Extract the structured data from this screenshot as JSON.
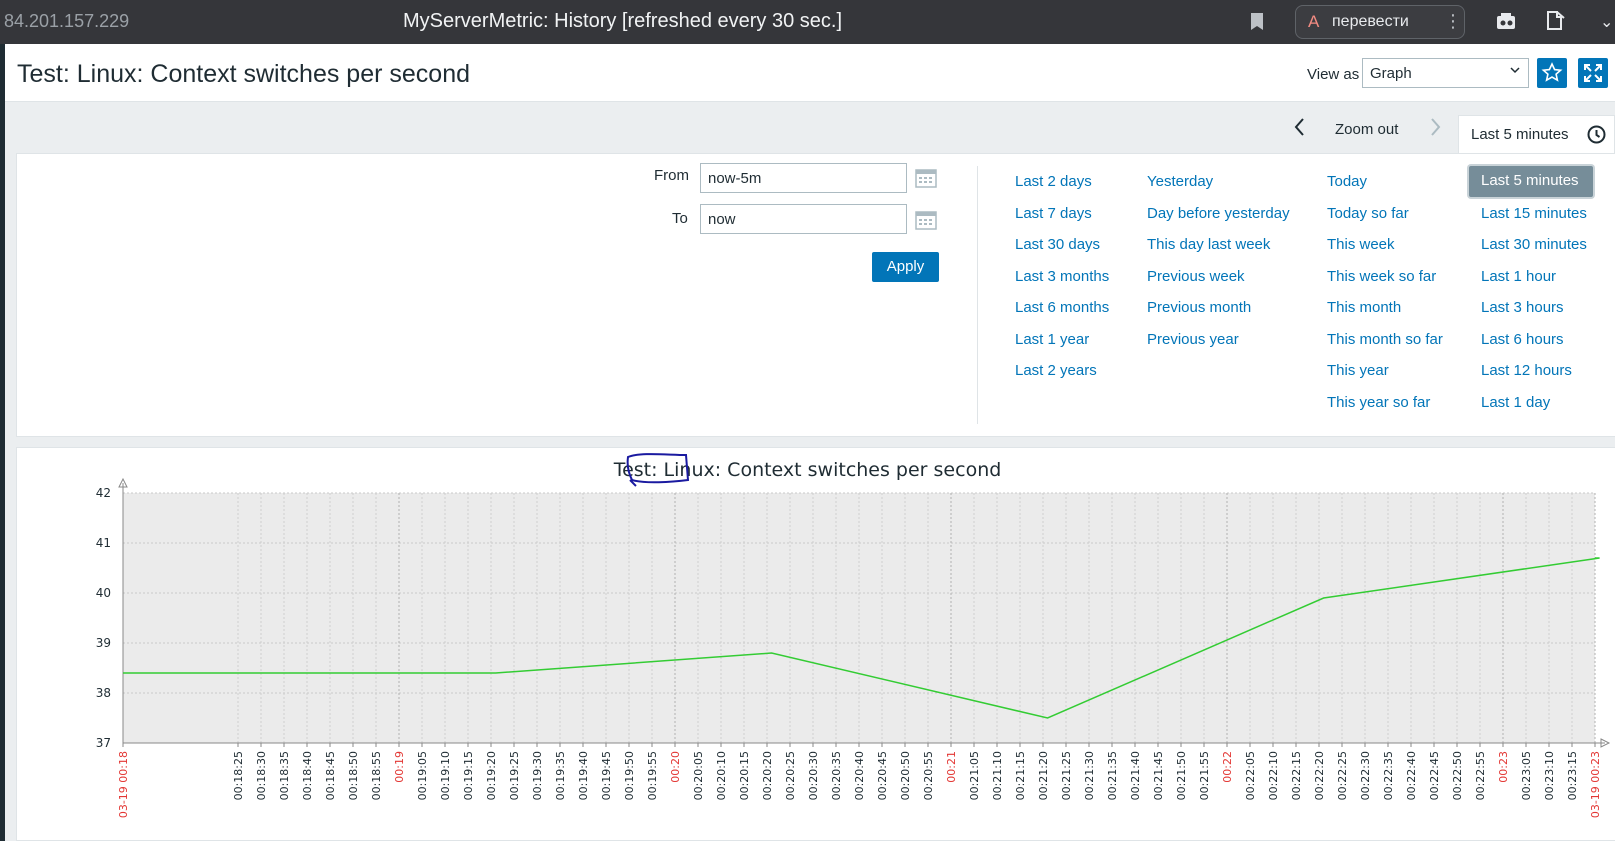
{
  "browser": {
    "address": "84.201.157.229",
    "window_title": "MyServerMetric: History [refreshed every 30 sec.]",
    "translate_label": "перевести"
  },
  "header": {
    "title": "Test: Linux: Context switches per second",
    "view_as_label": "View as",
    "view_as_value": "Graph"
  },
  "timenav": {
    "zoom_out": "Zoom out",
    "current_tab": "Last 5 minutes"
  },
  "filter": {
    "from_label": "From",
    "from_value": "now-5m",
    "to_label": "To",
    "to_value": "now",
    "apply": "Apply",
    "columns": [
      [
        "Last 2 days",
        "Last 7 days",
        "Last 30 days",
        "Last 3 months",
        "Last 6 months",
        "Last 1 year",
        "Last 2 years"
      ],
      [
        "Yesterday",
        "Day before yesterday",
        "This day last week",
        "Previous week",
        "Previous month",
        "Previous year"
      ],
      [
        "Today",
        "Today so far",
        "This week",
        "This week so far",
        "This month",
        "This month so far",
        "This year",
        "This year so far"
      ],
      [
        "Last 5 minutes",
        "Last 15 minutes",
        "Last 30 minutes",
        "Last 1 hour",
        "Last 3 hours",
        "Last 6 hours",
        "Last 12 hours",
        "Last 1 day"
      ]
    ],
    "selected": "Last 5 minutes"
  },
  "colors": {
    "accent": "#0275b8",
    "line": "#33cc33",
    "red_tick": "#e33734",
    "selected_bg": "#768d99"
  },
  "chart_data": {
    "type": "line",
    "title": "Test: Linux: Context switches per second",
    "ylim": [
      37,
      42
    ],
    "yticks": [
      37,
      38,
      39,
      40,
      41,
      42
    ],
    "x_start_label": "03-19 00:18",
    "x_end_label": "03-19 00:23",
    "x_ticks": [
      "00:18:25",
      "00:18:30",
      "00:18:35",
      "00:18:40",
      "00:18:45",
      "00:18:50",
      "00:18:55",
      "00:19",
      "00:19:05",
      "00:19:10",
      "00:19:15",
      "00:19:20",
      "00:19:25",
      "00:19:30",
      "00:19:35",
      "00:19:40",
      "00:19:45",
      "00:19:50",
      "00:19:55",
      "00:20",
      "00:20:05",
      "00:20:10",
      "00:20:15",
      "00:20:20",
      "00:20:25",
      "00:20:30",
      "00:20:35",
      "00:20:40",
      "00:20:45",
      "00:20:50",
      "00:20:55",
      "00:21",
      "00:21:05",
      "00:21:10",
      "00:21:15",
      "00:21:20",
      "00:21:25",
      "00:21:30",
      "00:21:35",
      "00:21:40",
      "00:21:45",
      "00:21:50",
      "00:21:55",
      "00:22",
      "00:22:05",
      "00:22:10",
      "00:22:15",
      "00:22:20",
      "00:22:25",
      "00:22:30",
      "00:22:35",
      "00:22:40",
      "00:22:45",
      "00:22:50",
      "00:22:55",
      "00:23",
      "00:23:05",
      "00:23:10",
      "00:23:15"
    ],
    "red_ticks": [
      "00:19",
      "00:20",
      "00:21",
      "00:22",
      "00:23"
    ],
    "series": [
      {
        "color": "#33cc33",
        "points": [
          {
            "t": "00:18:21",
            "v": 38.4
          },
          {
            "t": "00:19:21",
            "v": 38.4
          },
          {
            "t": "00:20:21",
            "v": 38.8
          },
          {
            "t": "00:21:21",
            "v": 37.5
          },
          {
            "t": "00:22:21",
            "v": 39.9
          },
          {
            "t": "00:23:21",
            "v": 40.7
          }
        ]
      }
    ],
    "grid": true
  }
}
